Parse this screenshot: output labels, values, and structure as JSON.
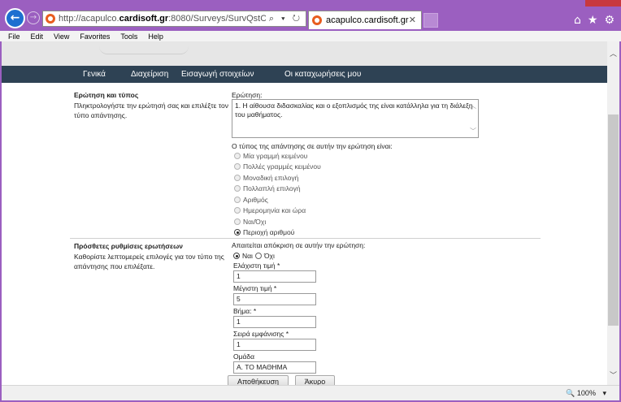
{
  "browser": {
    "url_prefix": "http://acapulco.",
    "url_domain": "cardisoft.gr",
    "url_rest": ":8080/Surveys/SurvQstCust.aspx?CatalogId=Survey",
    "address_tools": "⌕ ▾ ↻",
    "tab_title": "acapulco.cardisoft.gr",
    "tab_close": "✕",
    "home_icon": "⌂",
    "favorites_icon": "★",
    "tools_icon": "⚙",
    "back_icon": "←",
    "forward_icon": "→"
  },
  "menu": [
    "File",
    "Edit",
    "View",
    "Favorites",
    "Tools",
    "Help"
  ],
  "navbar": [
    "Γενικά",
    "Διαχείριση",
    "Εισαγωγή στοιχείων",
    "Οι καταχωρήσεις μου"
  ],
  "question_section": {
    "title": "Ερώτηση και τύπος",
    "description": "Πληκτρολογήστε την ερώτησή σας και επιλέξτε τον τύπο απάντησης.",
    "question_label": "Ερώτηση:",
    "question_text": "1. Η αίθουσα διδασκαλίας και ο εξοπλισμός της είναι κατάλληλα για τη διάλεξη του μαθήματος.",
    "type_label": "Ο τύπος της απάντησης σε αυτήν την ερώτηση είναι:",
    "types": [
      {
        "label": "Μία γραμμή κειμένου",
        "checked": false
      },
      {
        "label": "Πολλές γραμμές κειμένου",
        "checked": false
      },
      {
        "label": "Μοναδική επιλογή",
        "checked": false
      },
      {
        "label": "Πολλαπλή επιλογή",
        "checked": false
      },
      {
        "label": "Αριθμός",
        "checked": false
      },
      {
        "label": "Ημερομηνία και ώρα",
        "checked": false
      },
      {
        "label": "Ναι/Όχι",
        "checked": false
      },
      {
        "label": "Περιοχή αριθμού",
        "checked": true
      }
    ]
  },
  "additional_section": {
    "title": "Πρόσθετες ρυθμίσεις ερωτήσεων",
    "description": "Καθορίστε λεπτομερείς επιλογές για τον τύπο της απάντησης που επιλέξατε.",
    "required_label": "Απαιτείται απόκριση σε αυτήν την ερώτηση:",
    "yes_label": "Ναι",
    "no_label": "Όχι",
    "min_label": "Ελάχιστη τιμή *",
    "min_value": "1",
    "max_label": "Μέγιστη τιμή *",
    "max_value": "5",
    "step_label": "Βήμα: *",
    "step_value": "1",
    "order_label": "Σειρά εμφάνισης *",
    "order_value": "1",
    "group_label": "Ομάδα",
    "group_value": "Α. ΤΟ ΜΑΘΗΜΑ"
  },
  "buttons": {
    "save": "Αποθήκευση",
    "cancel": "Άκυρο"
  },
  "status": {
    "zoom": "100%",
    "zoom_icon": "🔍",
    "zoom_arrow": "▾"
  },
  "colors": {
    "frame": "#9b5fc0",
    "navbar": "#2e4254",
    "back_button": "#1e6fd0"
  }
}
